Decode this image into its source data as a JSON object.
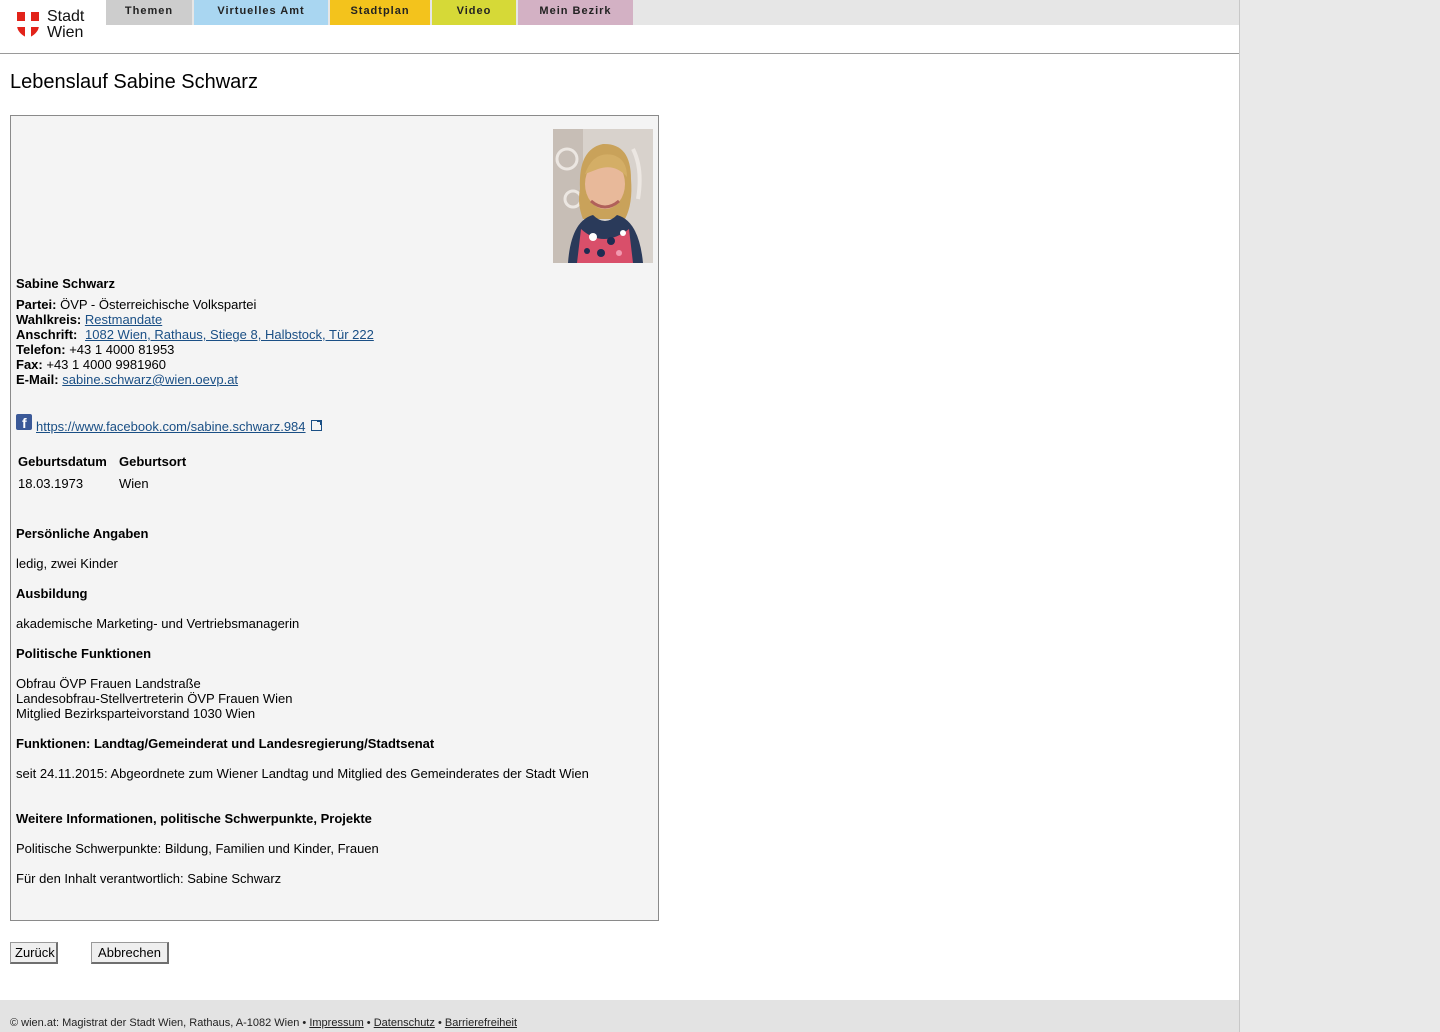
{
  "header": {
    "logo_line1": "Stadt",
    "logo_line2": "Wien",
    "tabs": [
      {
        "label": "Themen",
        "color": "#cdcdcd"
      },
      {
        "label": "Virtuelles Amt",
        "color": "#a9d6f1"
      },
      {
        "label": "Stadtplan",
        "color": "#f3c31c"
      },
      {
        "label": "Video",
        "color": "#d6d937"
      },
      {
        "label": "Mein Bezirk",
        "color": "#d3b1c4"
      }
    ]
  },
  "page_title": "Lebenslauf Sabine Schwarz",
  "profile": {
    "name": "Sabine Schwarz",
    "party_label": "Partei:",
    "party": "ÖVP - Österreichische Volkspartei",
    "district_label": "Wahlkreis:",
    "district": "Restmandate",
    "address_label": "Anschrift:",
    "address": "1082 Wien, Rathaus, Stiege 8, Halbstock, Tür 222",
    "phone_label": "Telefon:",
    "phone": "+43 1 4000 81953",
    "fax_label": "Fax:",
    "fax": "+43 1 4000 9981960",
    "email_label": "E-Mail:",
    "email": "sabine.schwarz@wien.oevp.at",
    "facebook": "https://www.facebook.com/sabine.schwarz.984",
    "birth_table": {
      "col1": "Geburtsdatum",
      "col2": "Geburtsort",
      "date": "18.03.1973",
      "place": "Wien"
    },
    "sections": {
      "personal_title": "Persönliche Angaben",
      "personal_text": "ledig, zwei Kinder",
      "education_title": "Ausbildung",
      "education_text": "akademische Marketing- und Vertriebsmanagerin",
      "political_title": "Politische Funktionen",
      "political_lines": [
        "Obfrau ÖVP Frauen Landstraße",
        "Landesobfrau-Stellvertreterin ÖVP Frauen Wien",
        "Mitglied Bezirksparteivorstand 1030 Wien"
      ],
      "functions_title": "Funktionen: Landtag/Gemeinderat und Landesregierung/Stadtsenat",
      "functions_text": "seit 24.11.2015: Abgeordnete zum Wiener Landtag und Mitglied des Gemeinderates der Stadt Wien",
      "more_title": "Weitere Informationen, politische Schwerpunkte, Projekte",
      "more_text": "Politische Schwerpunkte: Bildung, Familien und Kinder, Frauen",
      "responsible_text": "Für den Inhalt verantwortlich: Sabine Schwarz"
    }
  },
  "buttons": {
    "back": "Zurück",
    "cancel": "Abbrechen"
  },
  "footer": {
    "copyright": "© wien.at: Magistrat der Stadt Wien, Rathaus, A-1082 Wien •",
    "impressum": "Impressum",
    "sep1": "•",
    "privacy": "Datenschutz",
    "sep2": "•",
    "accessibility": "Barrierefreiheit"
  },
  "icons": {
    "shield": "vienna-shield-icon",
    "facebook": "facebook-icon",
    "external": "external-link-icon"
  }
}
